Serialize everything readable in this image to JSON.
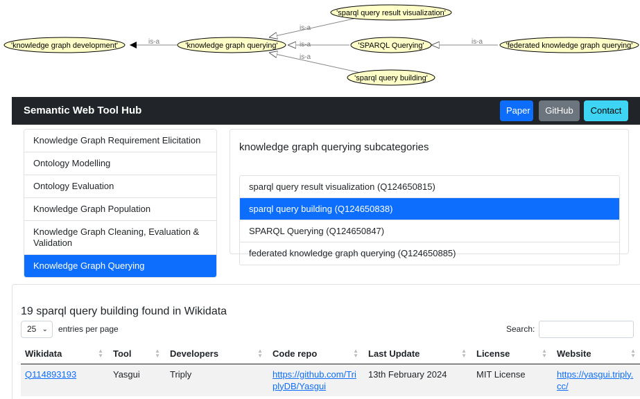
{
  "graph": {
    "nodes": {
      "kg_dev": "'knowledge graph development'",
      "kg_query": "'knowledge graph querying'",
      "viz": "'sparql query result visualization'",
      "sparql": "'SPARQL Querying'",
      "building": "'sparql query building'",
      "federated": "'federated knowledge graph querying'"
    },
    "edge_label": "is-a",
    "colors": {
      "node_fill": "#ffffc8",
      "node_stroke": "#000000",
      "edge": "#888888"
    }
  },
  "navbar": {
    "brand": "Semantic Web Tool Hub",
    "buttons": {
      "paper": "Paper",
      "github": "GitHub",
      "contact": "Contact"
    }
  },
  "sidebar": {
    "items": [
      {
        "label": "Knowledge Graph Requirement Elicitation"
      },
      {
        "label": "Ontology Modelling"
      },
      {
        "label": "Ontology Evaluation"
      },
      {
        "label": "Knowledge Graph Population"
      },
      {
        "label": "Knowledge Graph Cleaning, Evaluation & Validation"
      },
      {
        "label": "Knowledge Graph Querying"
      }
    ]
  },
  "subcategories": {
    "title": "knowledge graph querying subcategories",
    "items": [
      {
        "label": "sparql query result visualization (Q124650815)"
      },
      {
        "label": "sparql query building (Q124650838)"
      },
      {
        "label": "SPARQL Querying (Q124650847)"
      },
      {
        "label": "federated knowledge graph querying (Q124650885)"
      }
    ]
  },
  "results": {
    "title": "19 sparql query building found in Wikidata",
    "length_value": "25",
    "length_label": "entries per page",
    "search_label": "Search:",
    "search_placeholder": "",
    "columns": [
      "Wikidata",
      "Tool",
      "Developers",
      "Code repo",
      "Last Update",
      "License",
      "Website"
    ],
    "rows": [
      {
        "wikidata": "Q114893193",
        "tool": "Yasgui",
        "developers": "Triply",
        "code_repo": "https://github.com/TriplyDB/Yasgui",
        "last_update": "13th February 2024",
        "license": "MIT License",
        "website": "https://yasgui.triply.cc/"
      }
    ]
  },
  "colors": {
    "primary": "#0d6efd",
    "secondary": "#6c757d",
    "info": "#3dd5f3",
    "dark": "#212529"
  }
}
